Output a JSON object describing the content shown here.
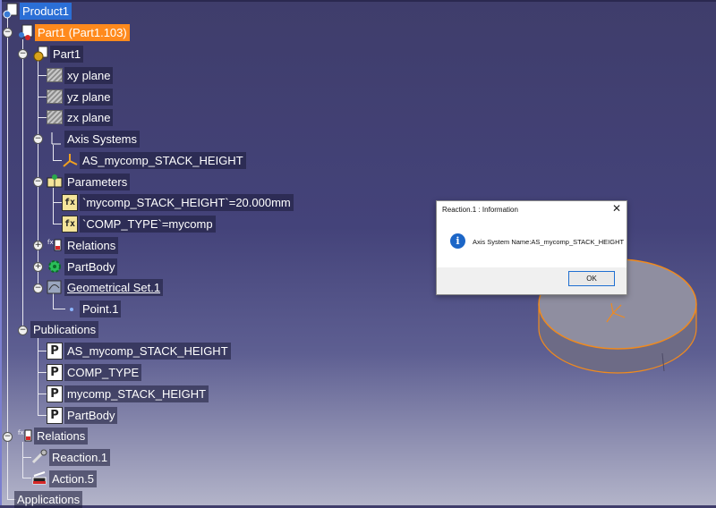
{
  "tree": {
    "product": "Product1",
    "part_instance": "Part1 (Part1.103)",
    "part": "Part1",
    "planes": [
      "xy plane",
      "yz plane",
      "zx plane"
    ],
    "axis_systems": "Axis Systems",
    "axis_system_item": "AS_mycomp_STACK_HEIGHT",
    "parameters": "Parameters",
    "param_1": "`mycomp_STACK_HEIGHT`=20.000mm",
    "param_2": "`COMP_TYPE`=mycomp",
    "relations": "Relations",
    "part_body": "PartBody",
    "geom_set": "Geometrical Set.1",
    "point": "Point.1",
    "publications": "Publications",
    "pubs": [
      "AS_mycomp_STACK_HEIGHT",
      "COMP_TYPE",
      "mycomp_STACK_HEIGHT",
      "PartBody"
    ],
    "product_relations": "Relations",
    "reaction": "Reaction.1",
    "action": "Action.5",
    "applications": "Applications"
  },
  "dialog": {
    "title": "Reaction.1 : Information",
    "close": "✕",
    "message": "Axis System Name:AS_mycomp_STACK_HEIGHT",
    "ok_label": "OK"
  },
  "colors": {
    "selection": "#2b6fd6",
    "part_highlight": "#ff8a1d",
    "background": "#44437a",
    "cylinder_edge": "#f08a1e"
  }
}
